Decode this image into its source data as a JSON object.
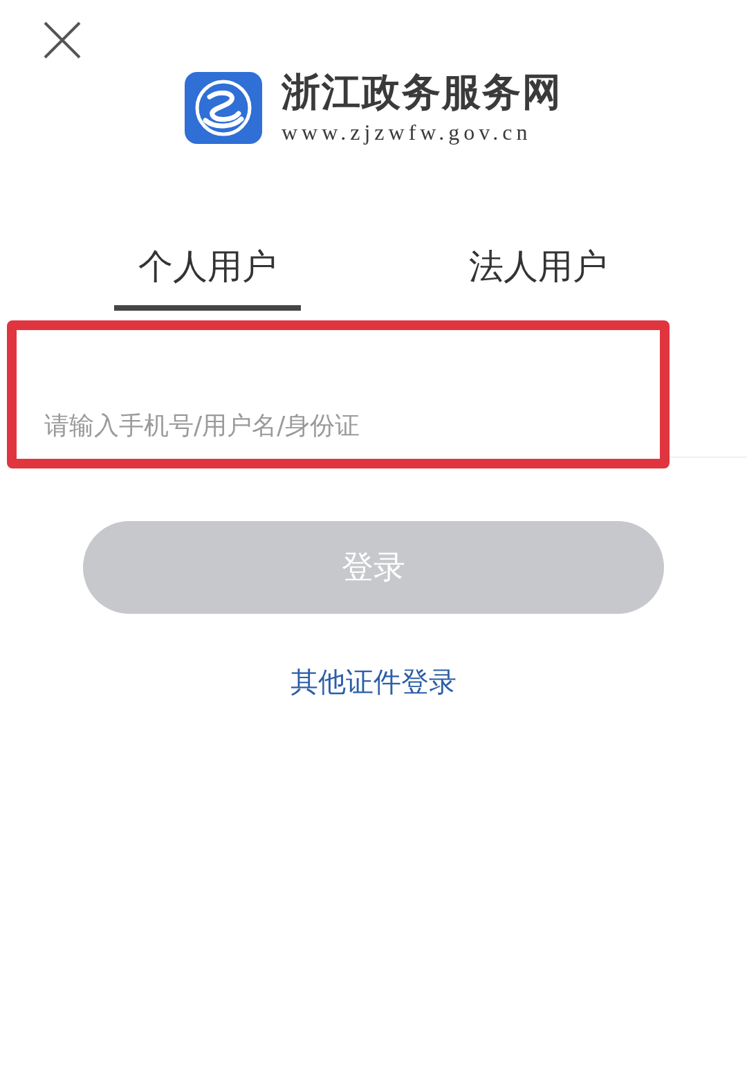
{
  "logo": {
    "title": "浙江政务服务网",
    "url": "www.zjzwfw.gov.cn"
  },
  "tabs": [
    {
      "label": "个人用户",
      "selected": true
    },
    {
      "label": "法人用户",
      "selected": false
    }
  ],
  "login_field": {
    "placeholder": "请输入手机号/用户名/身份证",
    "highlighted": true
  },
  "login_button": {
    "label": "登录",
    "disabled": true
  },
  "alt_login_link": "其他证件登录"
}
